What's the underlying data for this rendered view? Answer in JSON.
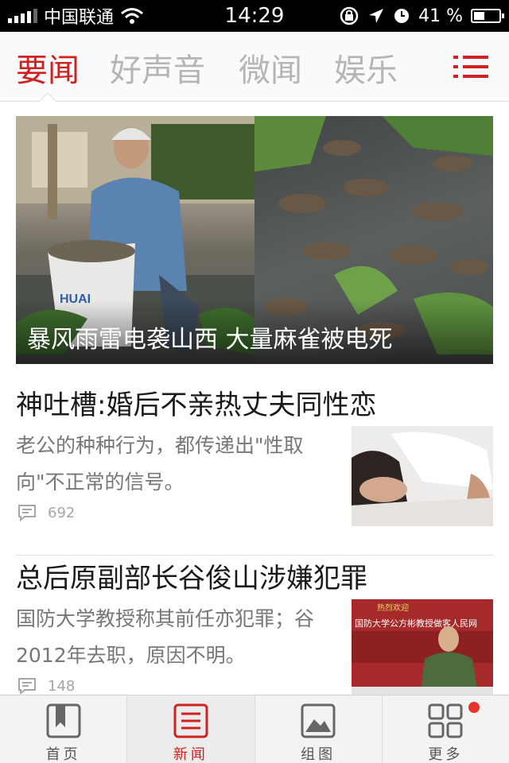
{
  "status_bar": {
    "carrier": "中国联通",
    "time": "14:29",
    "battery": "41 %",
    "icons": [
      "signal-icon",
      "wifi-icon",
      "rotation-lock-icon",
      "location-icon",
      "alarm-icon",
      "battery-icon"
    ]
  },
  "channels": {
    "tabs": [
      "要闻",
      "好声音",
      "微闻",
      "娱乐"
    ],
    "active": "要闻",
    "accent_color": "#d02020"
  },
  "hero": {
    "title": "暴风雨雷电袭山西 大量麻雀被电死",
    "bucket_text": "HUAI"
  },
  "articles": [
    {
      "title": "神吐槽:婚后不亲热丈夫同性恋",
      "summary": "老公的种种行为，都传递出\"性取向\"不正常的信号。",
      "comments": "692"
    },
    {
      "title": "总后原副部长谷俊山涉嫌犯罪",
      "summary": "国防大学教授称其前任亦犯罪；谷2012年去职，原因不明。",
      "comments": "148",
      "thumb_banner": "国防大学公方彬教授做客人民网",
      "thumb_banner_top": "热烈欢迎"
    }
  ],
  "bottom_nav": {
    "items": [
      "首页",
      "新闻",
      "组图",
      "更多"
    ],
    "active": "新闻"
  }
}
